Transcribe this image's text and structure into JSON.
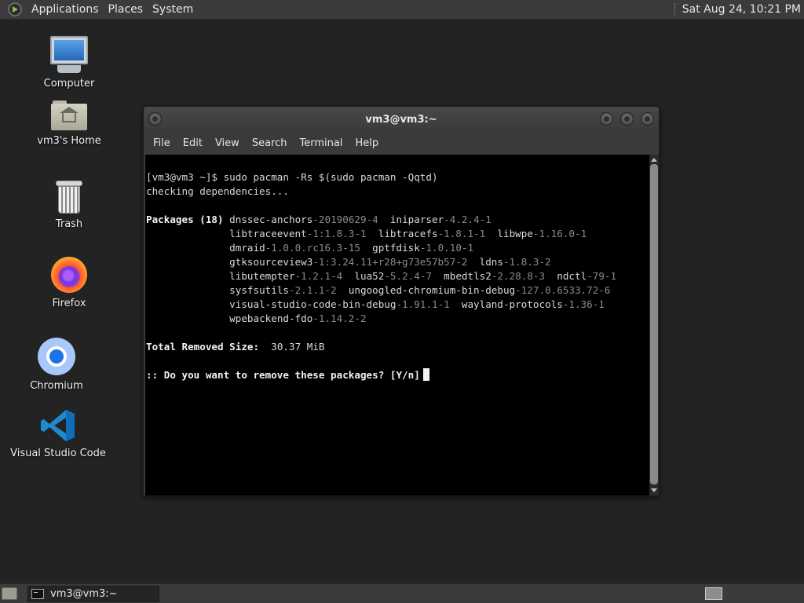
{
  "top_panel": {
    "menus": [
      "Applications",
      "Places",
      "System"
    ],
    "clock": "Sat Aug 24, 10:21 PM"
  },
  "desktop_icons": [
    {
      "label": "Computer",
      "icon": "computer-icon"
    },
    {
      "label": "vm3's Home",
      "icon": "home-folder-icon"
    },
    {
      "label": "Trash",
      "icon": "trash-icon"
    },
    {
      "label": "Firefox",
      "icon": "firefox-icon"
    },
    {
      "label": "Chromium",
      "icon": "chromium-icon"
    },
    {
      "label": "Visual Studio Code",
      "icon": "vscode-icon"
    }
  ],
  "terminal": {
    "title": "vm3@vm3:~",
    "menus": [
      "File",
      "Edit",
      "View",
      "Search",
      "Terminal",
      "Help"
    ],
    "lines": {
      "cmd": "[vm3@vm3 ~]$ sudo pacman -Rs $(sudo pacman -Qqtd)",
      "checking": "checking dependencies...",
      "packages_header": "Packages (18)",
      "total_label": "Total Removed Size:",
      "total_value": "30.37 MiB",
      "prompt": ":: Do you want to remove these packages? [Y/n]"
    },
    "packages": [
      [
        "dnssec-anchors",
        "-20190629-4"
      ],
      [
        "iniparser",
        "-4.2.4-1"
      ],
      [
        "libtraceevent",
        "-1:1.8.3-1"
      ],
      [
        "libtracefs",
        "-1.8.1-1"
      ],
      [
        "libwpe",
        "-1.16.0-1"
      ],
      [
        "dmraid",
        "-1.0.0.rc16.3-15"
      ],
      [
        "gptfdisk",
        "-1.0.10-1"
      ],
      [
        "gtksourceview3",
        "-1:3.24.11+r28+g73e57b57-2"
      ],
      [
        "ldns",
        "-1.8.3-2"
      ],
      [
        "libutempter",
        "-1.2.1-4"
      ],
      [
        "lua52",
        "-5.2.4-7"
      ],
      [
        "mbedtls2",
        "-2.28.8-3"
      ],
      [
        "ndctl",
        "-79-1"
      ],
      [
        "sysfsutils",
        "-2.1.1-2"
      ],
      [
        "ungoogled-chromium-bin-debug",
        "-127.0.6533.72-6"
      ],
      [
        "visual-studio-code-bin-debug",
        "-1.91.1-1"
      ],
      [
        "wayland-protocols",
        "-1.36-1"
      ],
      [
        "wpebackend-fdo",
        "-1.14.2-2"
      ]
    ]
  },
  "bottom_panel": {
    "task_label": "vm3@vm3:~"
  }
}
